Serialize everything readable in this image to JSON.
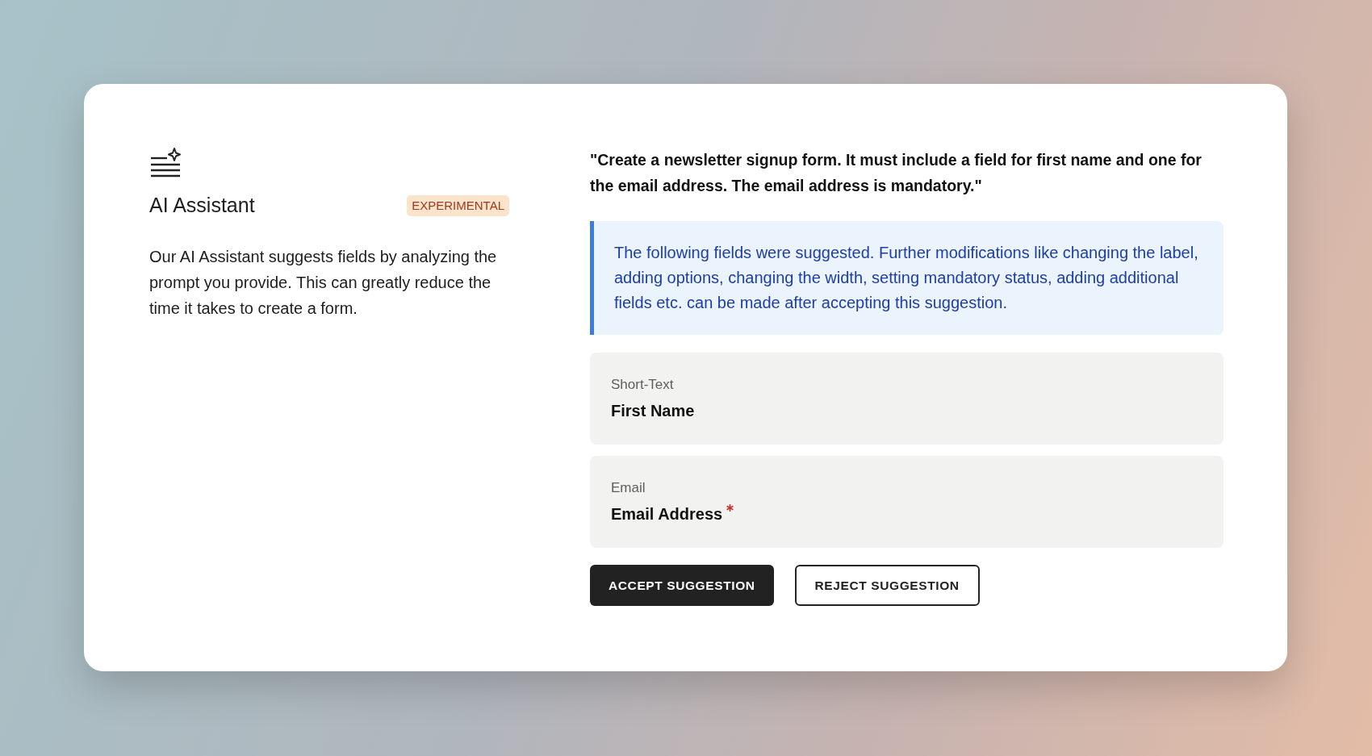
{
  "assistant": {
    "title": "AI Assistant",
    "badge": "EXPERIMENTAL",
    "description": "Our AI Assistant suggests fields by analyzing the prompt you provide. This can greatly reduce the time it takes to create a form."
  },
  "prompt": "\"Create a newsletter signup form. It must include a field for first name and one for the email address. The email address is mandatory.\"",
  "notice": "The following fields were suggested. Further modifications like changing the label, adding options, changing the width, setting mandatory status, adding additional fields etc. can be made after accepting this suggestion.",
  "fields": [
    {
      "type": "Short-Text",
      "label": "First Name",
      "required": false
    },
    {
      "type": "Email",
      "label": "Email Address",
      "required": true
    }
  ],
  "buttons": [
    {
      "label": "ACCEPT SUGGESTION",
      "kind": "primary"
    },
    {
      "label": "REJECT SUGGESTION",
      "kind": "secondary"
    }
  ]
}
